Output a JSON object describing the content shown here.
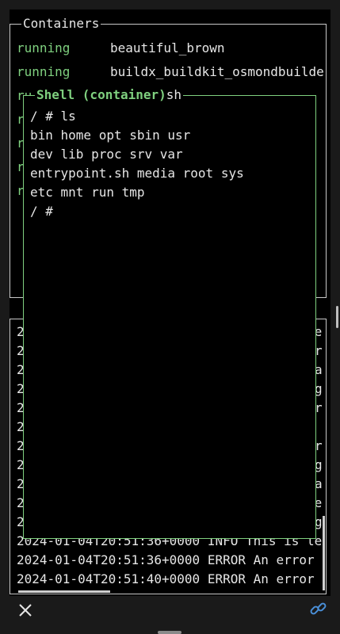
{
  "containers_panel": {
    "title": "Containers",
    "rows": [
      {
        "status": "running",
        "name": "beautiful_brown"
      },
      {
        "status": "running",
        "name": "buildx_buildkit_osmondbuilde"
      },
      {
        "status": "ru",
        "name": ""
      },
      {
        "status": "r",
        "name": ""
      },
      {
        "status": "r",
        "name": ""
      },
      {
        "status": "r",
        "name": ""
      },
      {
        "status": "r",
        "name": ""
      }
    ]
  },
  "shell_panel": {
    "title": "Shell (container)",
    "title_suffix": "sh",
    "lines": [
      "/ # ls",
      "bin home opt sbin usr",
      "dev lib proc srv var",
      "entrypoint.sh media root sys",
      "etc mnt run tmp",
      "/ #"
    ]
  },
  "logs_panel": {
    "clipped_right": [
      "le",
      "r",
      "a",
      "g",
      "r",
      "r",
      "g",
      "a",
      "le",
      "g"
    ],
    "lines": [
      "2024-01-04T20:51:36+0000 INFO This is le",
      "2024-01-04T20:51:36+0000 ERROR An error",
      "2024-01-04T20:51:40+0000 ERROR An error"
    ]
  },
  "bottom_bar": {
    "close_icon": "close-icon",
    "link_icon": "link-icon",
    "accent": "#4a90d9"
  },
  "colors": {
    "status": "#7fd07f",
    "shell_border": "#7fd07f",
    "background": "#000000"
  }
}
